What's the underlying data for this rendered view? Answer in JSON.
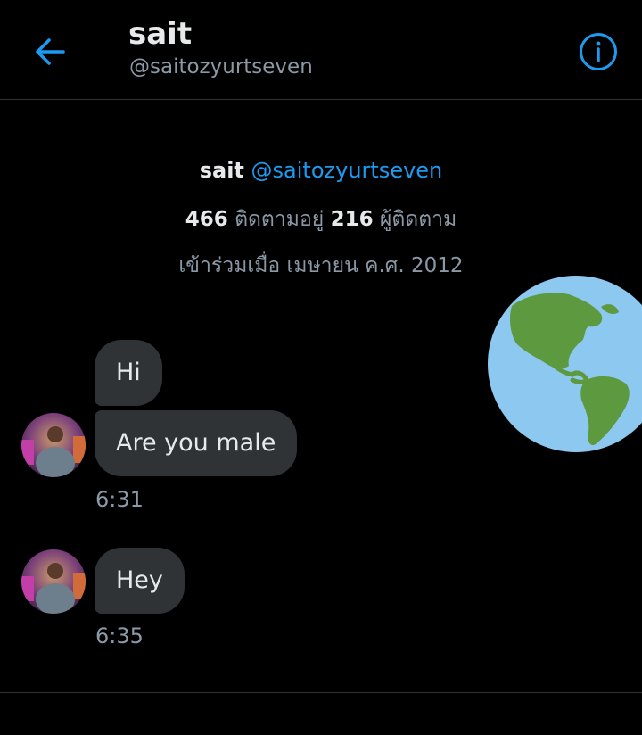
{
  "header": {
    "title": "sait",
    "handle": "@saitozyurtseven",
    "back_icon": "back-arrow-icon",
    "info_icon": "info-icon"
  },
  "profile": {
    "name": "sait",
    "handle": "@saitozyurtseven",
    "following_count": "466",
    "following_label": "ติดตามอยู่",
    "followers_count": "216",
    "followers_label": "ผู้ติดตาม",
    "joined": "เข้าร่วมเมื่อ เมษายน ค.ศ. 2012"
  },
  "messages": [
    {
      "text": "Hi"
    },
    {
      "text": "Are you male",
      "time": "6:31"
    },
    {
      "text": "Hey",
      "time": "6:35"
    }
  ],
  "sticker": "earth-globe-americas",
  "colors": {
    "background": "#000000",
    "accent": "#1d9bf0",
    "bubble": "#2f3336",
    "secondary_text": "#8b98a5"
  }
}
